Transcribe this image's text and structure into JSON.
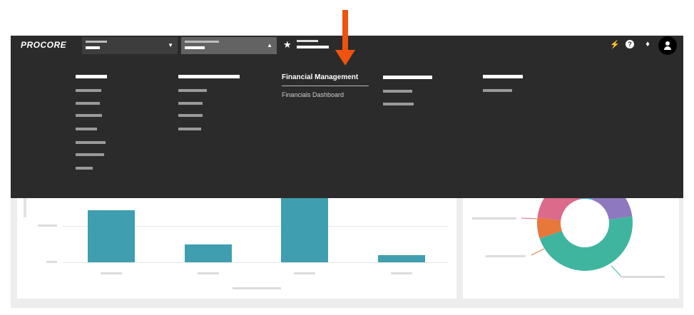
{
  "app": {
    "logo_text": "PROCORE"
  },
  "colors": {
    "nav_bg": "#2b2b2b",
    "accent_arrow": "#f0520f",
    "bar_color": "#3f9eaf",
    "donut": [
      "#8e78be",
      "#3fb5a0",
      "#e8773a",
      "#dc6a8a",
      "#4aaee0"
    ]
  },
  "header": {
    "icons": [
      "star-icon",
      "plug-icon",
      "help-icon",
      "bell-icon",
      "avatar"
    ]
  },
  "menu": {
    "financial_management": {
      "title": "Financial Management",
      "items": [
        "Financials Dashboard"
      ]
    }
  },
  "chart_data": [
    {
      "type": "bar",
      "values": [
        73,
        25,
        100,
        10
      ],
      "ylim": [
        0,
        100
      ]
    },
    {
      "type": "pie",
      "variant": "donut",
      "values": [
        18,
        47,
        7,
        20,
        8
      ]
    }
  ]
}
